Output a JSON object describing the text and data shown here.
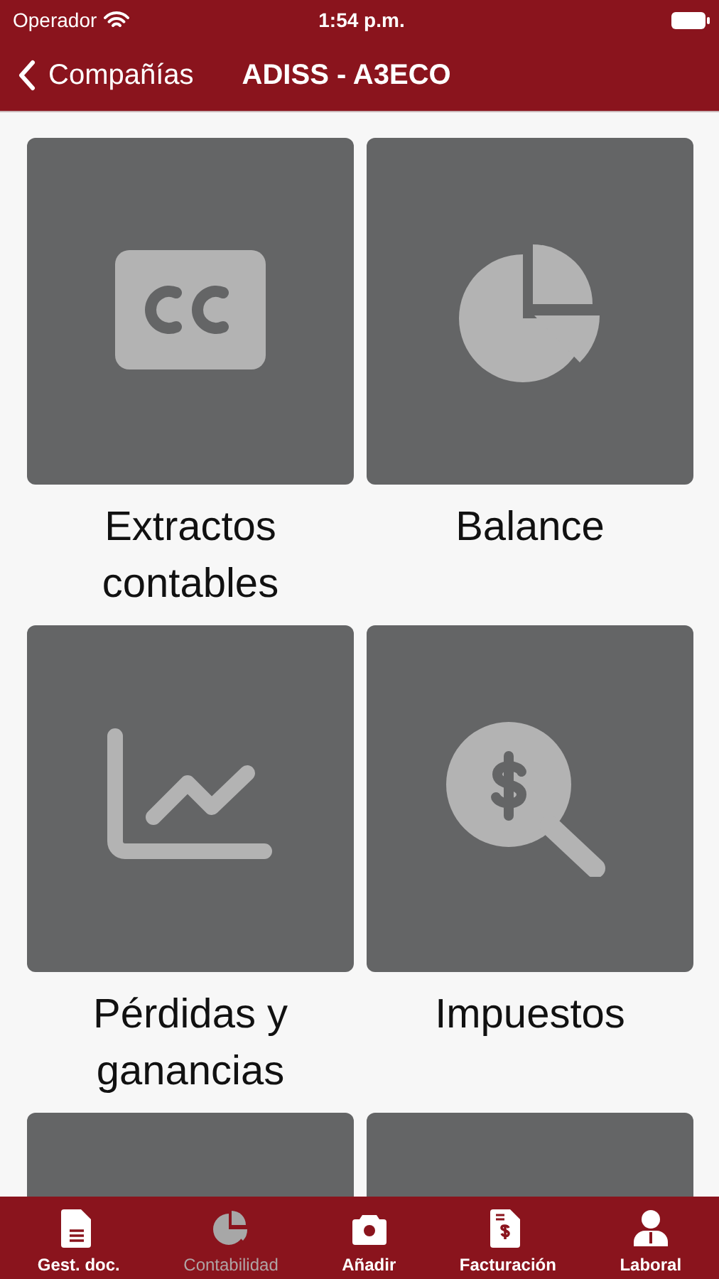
{
  "status_bar": {
    "carrier": "Operador",
    "time": "1:54 p.m."
  },
  "nav_bar": {
    "back": "Compañías",
    "title": "ADISS - A3ECO"
  },
  "tiles": [
    {
      "kind": "cc",
      "label": "Extractos contables"
    },
    {
      "kind": "pie",
      "label": "Balance"
    },
    {
      "kind": "chart",
      "label": "Pérdidas y ganancias"
    },
    {
      "kind": "tax",
      "label": "Impuestos"
    },
    {
      "kind": "hidden"
    },
    {
      "kind": "hidden"
    }
  ],
  "tab_bar": [
    {
      "kind": "doc",
      "label": "Gest. doc.",
      "selected": false
    },
    {
      "kind": "pie",
      "label": "Contabilidad",
      "selected": true
    },
    {
      "kind": "camera",
      "label": "Añadir",
      "selected": false
    },
    {
      "kind": "invoice",
      "label": "Facturación",
      "selected": false
    },
    {
      "kind": "person",
      "label": "Laboral",
      "selected": false
    }
  ]
}
